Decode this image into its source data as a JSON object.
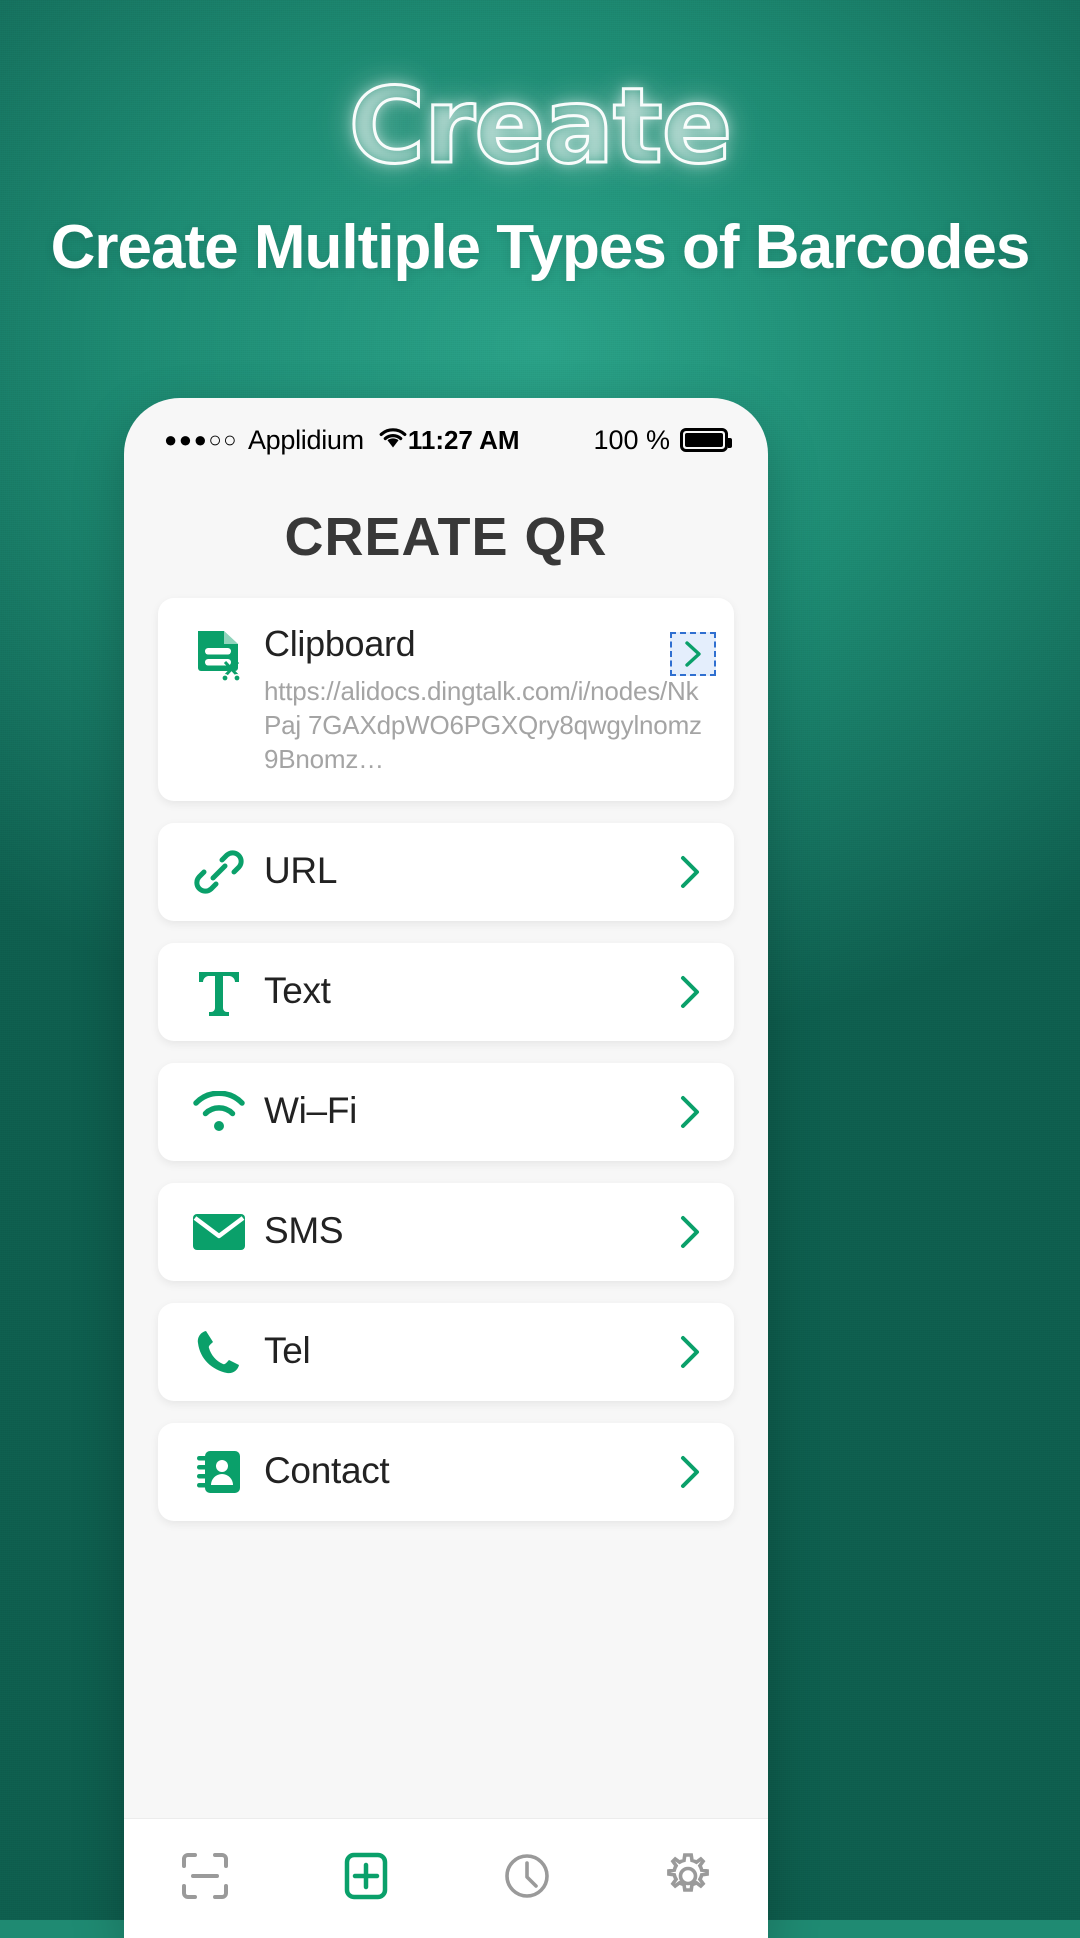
{
  "promo": {
    "outline_title": "Create",
    "subtitle": "Create Multiple Types of Barcodes",
    "bg_color": "#1d8a72",
    "accent_color": "#0aa06a"
  },
  "phone": {
    "statusbar": {
      "signal_dots": "●●●○○",
      "carrier": "Applidium",
      "wifi_icon": "wifi-icon",
      "time": "11:27 AM",
      "battery_percent": "100 %",
      "battery_icon": "battery-full-icon"
    },
    "page_title": "CREATE QR",
    "list": [
      {
        "icon": "clipboard-document-scissors-icon",
        "label": "Clipboard",
        "detail_line1": "https://alidocs.dingtalk.com/i/nodes/NkPaj",
        "detail_line2": "7GAXdpWO6PGXQry8qwgylnomz9Bnomz…",
        "chevron": "chevron-right-icon",
        "selected": true
      },
      {
        "icon": "link-icon",
        "label": "URL",
        "chevron": "chevron-right-icon",
        "selected": false
      },
      {
        "icon": "text-t-icon",
        "label": "Text",
        "chevron": "chevron-right-icon",
        "selected": false
      },
      {
        "icon": "wifi-icon",
        "label": "Wi–Fi",
        "chevron": "chevron-right-icon",
        "selected": false
      },
      {
        "icon": "envelope-icon",
        "label": "SMS",
        "chevron": "chevron-right-icon",
        "selected": false
      },
      {
        "icon": "phone-icon",
        "label": "Tel",
        "chevron": "chevron-right-icon",
        "selected": false
      },
      {
        "icon": "contact-card-icon",
        "label": "Contact",
        "chevron": "chevron-right-icon",
        "selected": false
      }
    ],
    "tabs": [
      {
        "icon": "scan-icon",
        "active": false
      },
      {
        "icon": "plus-box-icon",
        "active": true
      },
      {
        "icon": "clock-icon",
        "active": false
      },
      {
        "icon": "gear-icon",
        "active": false
      }
    ]
  }
}
